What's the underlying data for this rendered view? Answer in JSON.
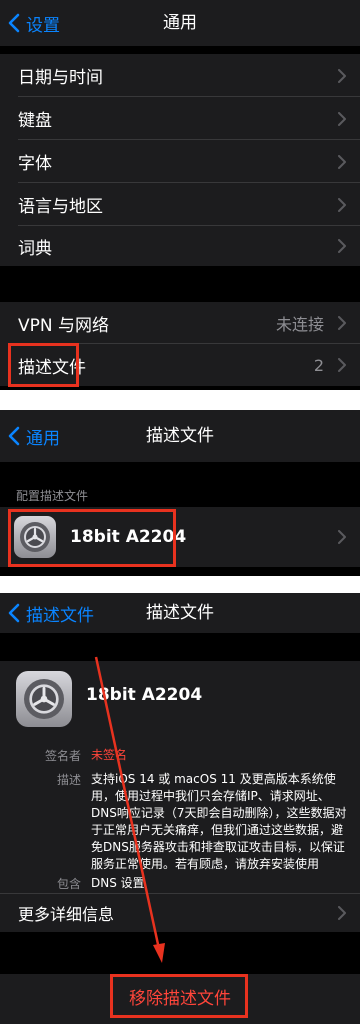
{
  "screen1": {
    "back_label": "设置",
    "title": "通用",
    "items": [
      {
        "label": "日期与时间"
      },
      {
        "label": "键盘"
      },
      {
        "label": "字体"
      },
      {
        "label": "语言与地区"
      },
      {
        "label": "词典"
      }
    ],
    "vpn": {
      "label": "VPN 与网络",
      "value": "未连接"
    },
    "profiles": {
      "label": "描述文件",
      "value": "2"
    }
  },
  "screen2": {
    "back_label": "通用",
    "title": "描述文件",
    "section_header": "配置描述文件",
    "profile_name": "18bit A2204"
  },
  "screen3": {
    "back_label": "描述文件",
    "title": "描述文件",
    "profile_name": "18bit A2204",
    "signed_by_label": "签名者",
    "signed_by_value": "未签名",
    "description_label": "描述",
    "description_value": "支持iOS 14 或 macOS 11 及更高版本系统使用，使用过程中我们只会存储IP、请求网址、DNS响应记录（7天即会自动删除），这些数据对于正常用户无关痛痒，但我们通过这些数据，避免DNS服务器攻击和排查取证攻击目标，以保证服务正常使用。若有顾虑，请放弃安装使用",
    "contains_label": "包含",
    "contains_value": "DNS 设置",
    "more_details": "更多详细信息",
    "remove_button": "移除描述文件"
  },
  "colors": {
    "accent": "#0a84ff",
    "annotation_red": "#e8321f",
    "unsigned_red": "#ff453a",
    "cell_bg": "#1c1c1e",
    "secondary_text": "#8e8e93"
  },
  "icons": [
    "chevron-left-icon",
    "chevron-right-icon",
    "settings-gear-icon",
    "annotation-arrow"
  ]
}
